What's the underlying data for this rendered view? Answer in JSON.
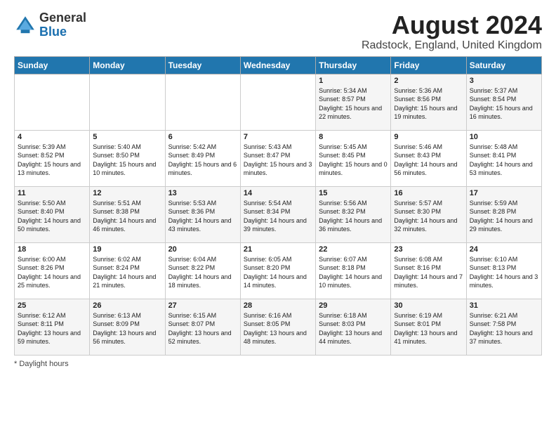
{
  "logo": {
    "general": "General",
    "blue": "Blue"
  },
  "header": {
    "title": "August 2024",
    "subtitle": "Radstock, England, United Kingdom"
  },
  "columns": [
    "Sunday",
    "Monday",
    "Tuesday",
    "Wednesday",
    "Thursday",
    "Friday",
    "Saturday"
  ],
  "footer": {
    "note": "Daylight hours"
  },
  "weeks": [
    [
      {
        "day": "",
        "info": ""
      },
      {
        "day": "",
        "info": ""
      },
      {
        "day": "",
        "info": ""
      },
      {
        "day": "",
        "info": ""
      },
      {
        "day": "1",
        "info": "Sunrise: 5:34 AM\nSunset: 8:57 PM\nDaylight: 15 hours\nand 22 minutes."
      },
      {
        "day": "2",
        "info": "Sunrise: 5:36 AM\nSunset: 8:56 PM\nDaylight: 15 hours\nand 19 minutes."
      },
      {
        "day": "3",
        "info": "Sunrise: 5:37 AM\nSunset: 8:54 PM\nDaylight: 15 hours\nand 16 minutes."
      }
    ],
    [
      {
        "day": "4",
        "info": "Sunrise: 5:39 AM\nSunset: 8:52 PM\nDaylight: 15 hours\nand 13 minutes."
      },
      {
        "day": "5",
        "info": "Sunrise: 5:40 AM\nSunset: 8:50 PM\nDaylight: 15 hours\nand 10 minutes."
      },
      {
        "day": "6",
        "info": "Sunrise: 5:42 AM\nSunset: 8:49 PM\nDaylight: 15 hours\nand 6 minutes."
      },
      {
        "day": "7",
        "info": "Sunrise: 5:43 AM\nSunset: 8:47 PM\nDaylight: 15 hours\nand 3 minutes."
      },
      {
        "day": "8",
        "info": "Sunrise: 5:45 AM\nSunset: 8:45 PM\nDaylight: 15 hours\nand 0 minutes."
      },
      {
        "day": "9",
        "info": "Sunrise: 5:46 AM\nSunset: 8:43 PM\nDaylight: 14 hours\nand 56 minutes."
      },
      {
        "day": "10",
        "info": "Sunrise: 5:48 AM\nSunset: 8:41 PM\nDaylight: 14 hours\nand 53 minutes."
      }
    ],
    [
      {
        "day": "11",
        "info": "Sunrise: 5:50 AM\nSunset: 8:40 PM\nDaylight: 14 hours\nand 50 minutes."
      },
      {
        "day": "12",
        "info": "Sunrise: 5:51 AM\nSunset: 8:38 PM\nDaylight: 14 hours\nand 46 minutes."
      },
      {
        "day": "13",
        "info": "Sunrise: 5:53 AM\nSunset: 8:36 PM\nDaylight: 14 hours\nand 43 minutes."
      },
      {
        "day": "14",
        "info": "Sunrise: 5:54 AM\nSunset: 8:34 PM\nDaylight: 14 hours\nand 39 minutes."
      },
      {
        "day": "15",
        "info": "Sunrise: 5:56 AM\nSunset: 8:32 PM\nDaylight: 14 hours\nand 36 minutes."
      },
      {
        "day": "16",
        "info": "Sunrise: 5:57 AM\nSunset: 8:30 PM\nDaylight: 14 hours\nand 32 minutes."
      },
      {
        "day": "17",
        "info": "Sunrise: 5:59 AM\nSunset: 8:28 PM\nDaylight: 14 hours\nand 29 minutes."
      }
    ],
    [
      {
        "day": "18",
        "info": "Sunrise: 6:00 AM\nSunset: 8:26 PM\nDaylight: 14 hours\nand 25 minutes."
      },
      {
        "day": "19",
        "info": "Sunrise: 6:02 AM\nSunset: 8:24 PM\nDaylight: 14 hours\nand 21 minutes."
      },
      {
        "day": "20",
        "info": "Sunrise: 6:04 AM\nSunset: 8:22 PM\nDaylight: 14 hours\nand 18 minutes."
      },
      {
        "day": "21",
        "info": "Sunrise: 6:05 AM\nSunset: 8:20 PM\nDaylight: 14 hours\nand 14 minutes."
      },
      {
        "day": "22",
        "info": "Sunrise: 6:07 AM\nSunset: 8:18 PM\nDaylight: 14 hours\nand 10 minutes."
      },
      {
        "day": "23",
        "info": "Sunrise: 6:08 AM\nSunset: 8:16 PM\nDaylight: 14 hours\nand 7 minutes."
      },
      {
        "day": "24",
        "info": "Sunrise: 6:10 AM\nSunset: 8:13 PM\nDaylight: 14 hours\nand 3 minutes."
      }
    ],
    [
      {
        "day": "25",
        "info": "Sunrise: 6:12 AM\nSunset: 8:11 PM\nDaylight: 13 hours\nand 59 minutes."
      },
      {
        "day": "26",
        "info": "Sunrise: 6:13 AM\nSunset: 8:09 PM\nDaylight: 13 hours\nand 56 minutes."
      },
      {
        "day": "27",
        "info": "Sunrise: 6:15 AM\nSunset: 8:07 PM\nDaylight: 13 hours\nand 52 minutes."
      },
      {
        "day": "28",
        "info": "Sunrise: 6:16 AM\nSunset: 8:05 PM\nDaylight: 13 hours\nand 48 minutes."
      },
      {
        "day": "29",
        "info": "Sunrise: 6:18 AM\nSunset: 8:03 PM\nDaylight: 13 hours\nand 44 minutes."
      },
      {
        "day": "30",
        "info": "Sunrise: 6:19 AM\nSunset: 8:01 PM\nDaylight: 13 hours\nand 41 minutes."
      },
      {
        "day": "31",
        "info": "Sunrise: 6:21 AM\nSunset: 7:58 PM\nDaylight: 13 hours\nand 37 minutes."
      }
    ]
  ]
}
